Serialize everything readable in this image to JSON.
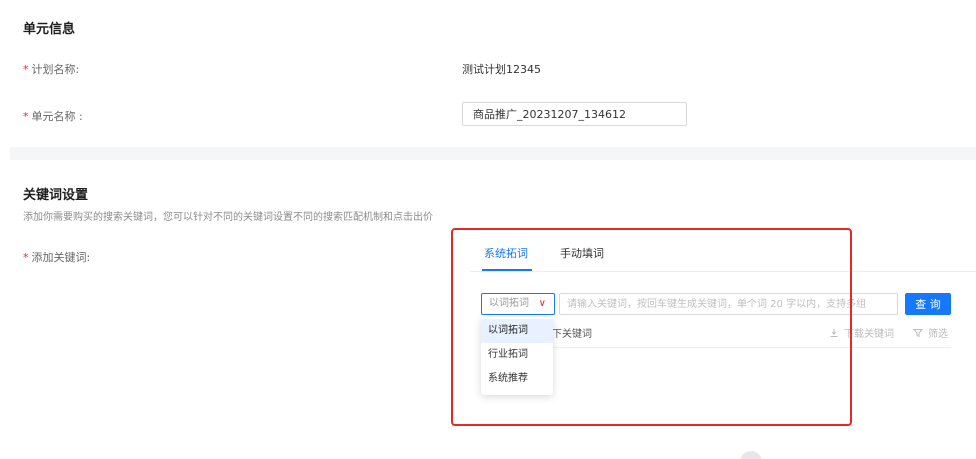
{
  "unit_info": {
    "title": "单元信息",
    "required_mark": "*",
    "plan_name_label": "计划名称:",
    "plan_name_value": "测试计划12345",
    "unit_name_label": "单元名称 :",
    "unit_name_value": "商品推广_20231207_134612"
  },
  "keyword_settings": {
    "title": "关键词设置",
    "description": "添加你需要购买的搜索关键词，您可以针对不同的关键词设置不同的搜索匹配机制和点击出价",
    "add_keyword_label": "添加关键词:",
    "tabs": [
      {
        "label": "系统拓词",
        "active": true
      },
      {
        "label": "手动填词",
        "active": false
      }
    ],
    "select": {
      "value": "以词拓词",
      "chevron": "∨"
    },
    "keyword_input_placeholder": "请输入关键词，按回车键生成关键词，单个词 20 字以内，支持多组",
    "query_button": "查 询",
    "table_header_text": "下关键词",
    "download_label": "下载关键词",
    "download_icon": "download-icon",
    "filter_label": "筛选",
    "filter_icon": "filter-icon",
    "dropdown_options": [
      {
        "label": "以词拓词",
        "selected": true
      },
      {
        "label": "行业拓词",
        "selected": false
      },
      {
        "label": "系统推荐",
        "selected": false
      }
    ]
  },
  "colors": {
    "accent": "#1677ff",
    "required": "#f5222d",
    "highlight_border": "#e32a2a"
  }
}
